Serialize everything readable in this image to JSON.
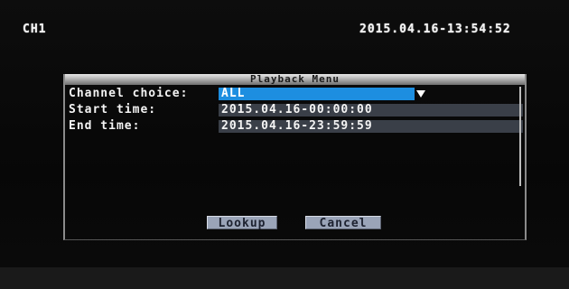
{
  "osd": {
    "channel": "CH1",
    "datetime": "2015.04.16-13:54:52"
  },
  "menu": {
    "title": "Playback Menu",
    "channel_choice": {
      "label": "Channel choice:",
      "value": "ALL"
    },
    "start_time": {
      "label": "Start time:",
      "value": "2015.04.16-00:00:00"
    },
    "end_time": {
      "label": "End time:",
      "value": "2015.04.16-23:59:59"
    },
    "buttons": {
      "lookup": "Lookup",
      "cancel": "Cancel"
    }
  },
  "colors": {
    "selected_field": "#1d8ee0",
    "field_bg": "#3a3f48",
    "button_bg": "#9aa4b8"
  },
  "icons": {
    "dropdown": "chevron-down-icon"
  }
}
